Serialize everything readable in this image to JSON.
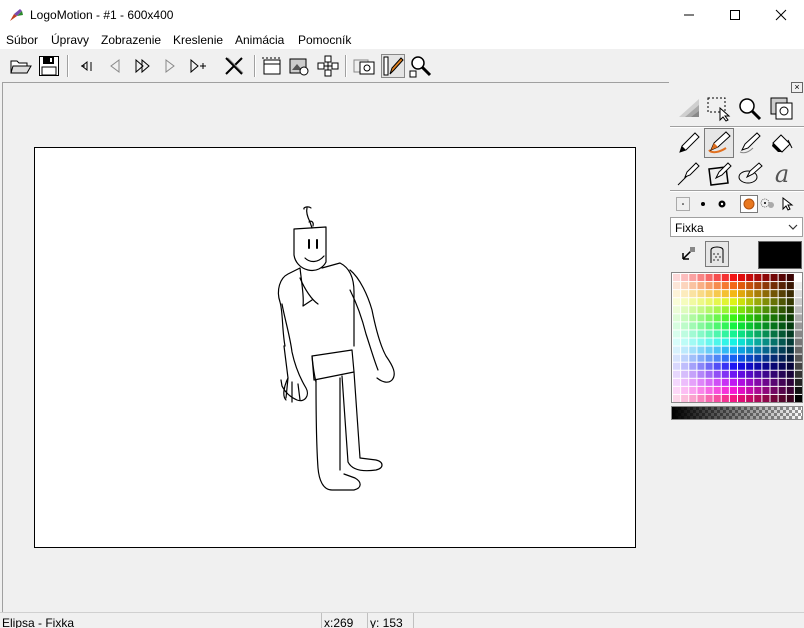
{
  "window": {
    "title": "LogoMotion - #1 - 600x400",
    "app_icon": "logomotion-app-icon",
    "controls": [
      "minimize-icon",
      "maximize-icon",
      "close-icon"
    ]
  },
  "menu": {
    "items": [
      {
        "label": "Súbor"
      },
      {
        "label": "Úpravy"
      },
      {
        "label": "Zobrazenie"
      },
      {
        "label": "Kreslenie"
      },
      {
        "label": "Animácia"
      },
      {
        "label": "Pomocník"
      }
    ]
  },
  "toolbar": {
    "buttons": [
      {
        "icon": "open-folder-icon"
      },
      {
        "icon": "save-disk-icon"
      },
      {
        "icon": "first-frame-icon"
      },
      {
        "icon": "previous-frame-icon"
      },
      {
        "icon": "play-icon"
      },
      {
        "icon": "next-frame-icon"
      },
      {
        "icon": "add-frame-icon"
      },
      {
        "icon": "delete-frame-icon"
      },
      {
        "icon": "frame-settings-icon"
      },
      {
        "icon": "picture-frame-icon"
      },
      {
        "icon": "move-nodes-icon"
      },
      {
        "icon": "onion-skin-icon"
      },
      {
        "icon": "draw-mode-icon",
        "pressed": true
      },
      {
        "icon": "zoom-tool-icon"
      }
    ]
  },
  "tools_panel": {
    "close_label": "×",
    "rows": [
      [
        "fill-gradient-icon",
        "rect-select-icon",
        "magnifier-icon",
        "copy-frame-icon"
      ],
      [
        "pencil-icon",
        "marker-icon",
        "pen-icon",
        "paint-bucket-icon"
      ],
      [
        "line-icon",
        "rectangle-icon",
        "ellipse-icon",
        "text-icon"
      ]
    ],
    "pressed_tool": "marker-icon",
    "text_tool_label": "a",
    "brush_sizes": [
      "tiny-dot-icon",
      "small-dot-icon",
      "medium-dot-icon",
      "orange-circle-icon",
      "spray-icon",
      "cursor-icon"
    ],
    "brush_selected": "orange-circle-icon",
    "brush_type": "Fixka",
    "swap_colors_icon": "swap-colors-icon",
    "transparency_icon": "transparency-icon",
    "current_color": "#000000"
  },
  "status": {
    "tool": "Elipsa - Fixka",
    "x": "x:269",
    "y": "y: 153"
  }
}
